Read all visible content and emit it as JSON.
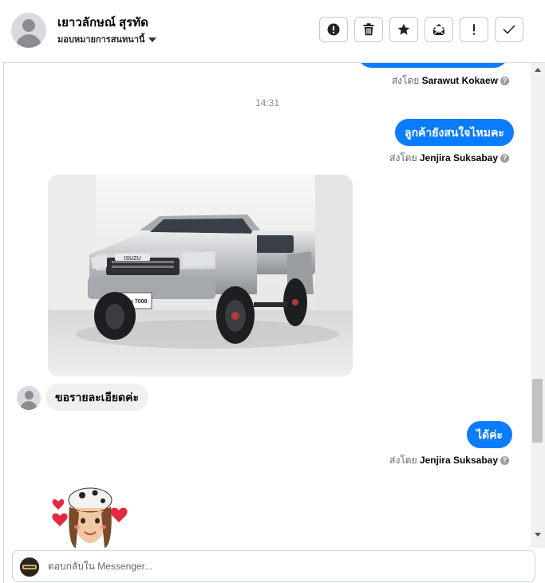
{
  "header": {
    "contact_name": "เยาวลักษณ์ สุรทัด",
    "assign_label": "มอบหมายการสนทนานี้",
    "actions": [
      {
        "name": "spam-report",
        "icon": "exclamation-circle-icon"
      },
      {
        "name": "delete",
        "icon": "trash-icon"
      },
      {
        "name": "star",
        "icon": "star-icon"
      },
      {
        "name": "mark-unread",
        "icon": "envelope-open-icon"
      },
      {
        "name": "follow-up",
        "icon": "exclamation-icon"
      },
      {
        "name": "mark-done",
        "icon": "checkmark-icon"
      }
    ]
  },
  "conversation": {
    "first_sent_by_prefix": "ส่งโดย",
    "first_sent_by_name": "Sarawut Kokaew",
    "timestamp": "14:31",
    "msg1_text": "ลูกค้ายังสนใจไหมคะ",
    "msg1_sent_by_prefix": "ส่งโดย",
    "msg1_sent_by_name": "Jenjira Suksabay",
    "photo_plate": "ขม 7008",
    "photo_badge": "ISUZU",
    "incoming_text": "ขอรายละเอียดค่ะ",
    "msg2_text": "ได้ค่ะ",
    "msg2_sent_by_prefix": "ส่งโดย",
    "msg2_sent_by_name": "Jenjira Suksabay",
    "help_mark": "?"
  },
  "reply": {
    "placeholder": "ตอบกลับใน Messenger..."
  },
  "colors": {
    "accent": "#0a7cff",
    "incoming_bubble": "#f0f0f0",
    "muted_text": "#65676b"
  }
}
